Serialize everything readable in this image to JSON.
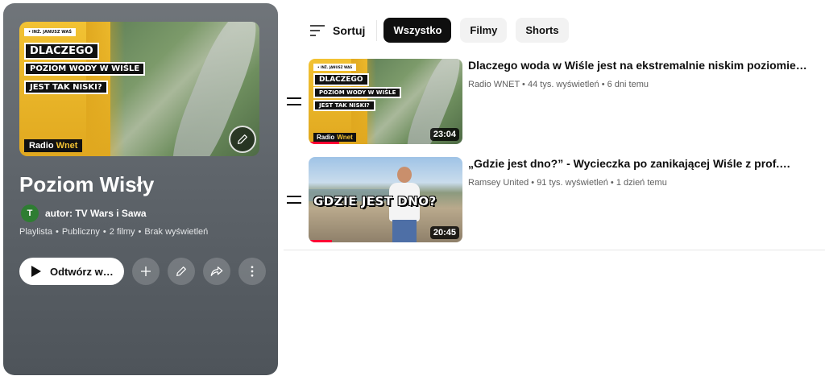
{
  "playlist": {
    "title": "Poziom Wisły",
    "author_label": "autor: TV Wars i Sawa",
    "avatar_letter": "T",
    "meta": [
      "Playlista",
      "Publiczny",
      "2 filmy",
      "Brak wyświetleń"
    ],
    "meta_separator": "•",
    "play_label": "Odtwórz w…",
    "hero": {
      "author": "• INŻ. JANUSZ WAŚ",
      "line1": "DLACZEGO",
      "line2": "POZIOM WODY W WIŚLE",
      "line3": "JEST TAK NISKI?",
      "brand_a": "Radio ",
      "brand_b": "Wnet"
    },
    "icons": {
      "edit": "pencil-icon",
      "add": "plus-icon",
      "edit_action": "pencil-icon",
      "share": "share-icon",
      "more": "more-vertical-icon",
      "play": "play-icon"
    }
  },
  "filters": {
    "sort_label": "Sortuj",
    "chips": [
      {
        "label": "Wszystko",
        "active": true
      },
      {
        "label": "Filmy",
        "active": false
      },
      {
        "label": "Shorts",
        "active": false
      }
    ]
  },
  "videos": [
    {
      "title": "Dlaczego woda w Wiśle jest na ekstremalnie niskim poziomie…",
      "channel": "Radio WNET",
      "views": "44 tys. wyświetleń",
      "age": "6 dni temu",
      "duration": "23:04",
      "progress": 0.2
    },
    {
      "title": "„Gdzie jest dno?” - Wycieczka po zanikającej Wiśle z prof.…",
      "channel": "Ramsey United",
      "views": "91 tys. wyświetleń",
      "age": "1 dzień temu",
      "duration": "20:45",
      "progress": 0.15,
      "caption": "GDZIE JEST DNO?"
    }
  ],
  "colors": {
    "panel": "#5f656b",
    "accent_yellow": "#f2c233",
    "progress_red": "#ff0033",
    "chip_active": "#0f0f0f"
  }
}
